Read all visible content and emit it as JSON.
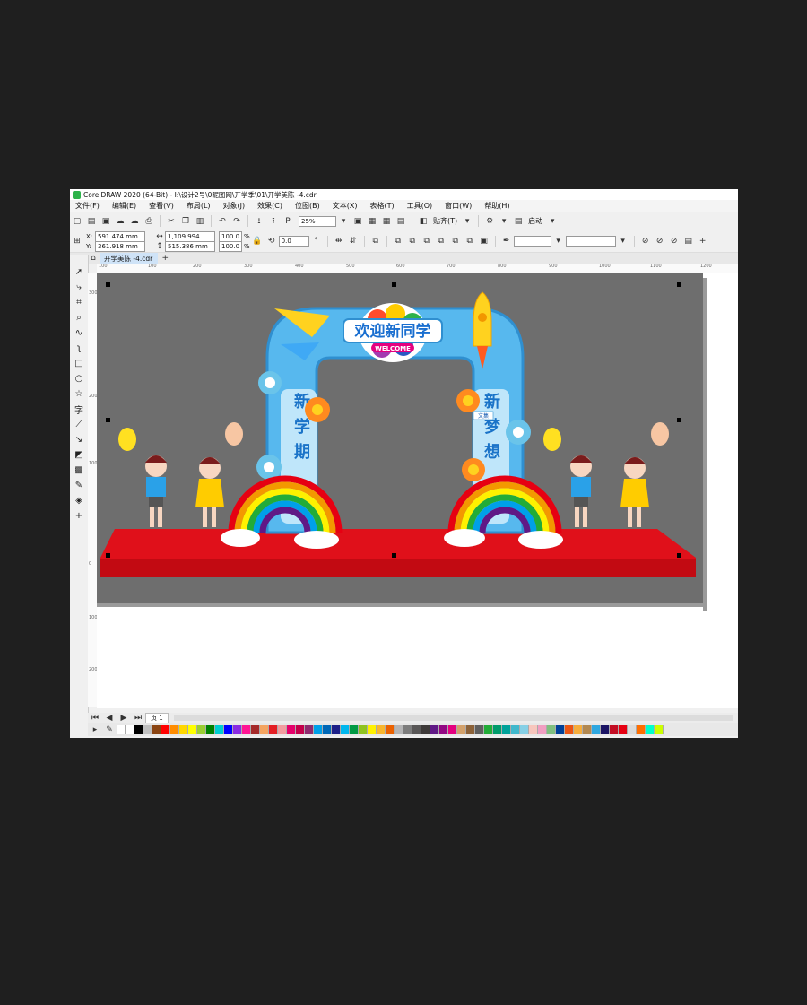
{
  "window": {
    "title": "CorelDRAW 2020 (64-Bit) - I:\\设计2号\\0昵图网\\开学季\\01\\开学美陈 -4.cdr"
  },
  "menu": [
    "文件(F)",
    "编辑(E)",
    "查看(V)",
    "布局(L)",
    "对象(J)",
    "效果(C)",
    "位图(B)",
    "文本(X)",
    "表格(T)",
    "工具(O)",
    "窗口(W)",
    "帮助(H)"
  ],
  "toolbar": {
    "zoom": "25%",
    "paste_label": "贴齐(T)",
    "launch_label": "启动"
  },
  "props": {
    "x": "591.474 mm",
    "y": "361.918 mm",
    "w": "1,109.994 mm",
    "h": "515.386 mm",
    "sx": "100.0",
    "sy": "100.0",
    "pct": "%",
    "angle": "0.0",
    "x_label": "X:",
    "y_label": "Y:"
  },
  "document": {
    "tab": "开学美陈 -4.cdr",
    "page_tab": "页 1"
  },
  "ruler": {
    "h": [
      "100",
      "200",
      "300",
      "400",
      "500",
      "600",
      "700",
      "800",
      "900",
      "1000",
      "1100",
      "1200"
    ],
    "v": [
      "300",
      "200",
      "100",
      "0",
      "100",
      "200"
    ]
  },
  "artwork": {
    "banner_cn": "欢迎新同学",
    "banner_en": "WELCOME",
    "left_column": [
      "新",
      "学",
      "期"
    ],
    "right_column": [
      "新",
      "梦",
      "想"
    ],
    "hint_label": "文集",
    "colors": {
      "stage_bg": "#6e6e6e",
      "floor": "#e0101a",
      "arch": "#57b8ee",
      "arch_inner": "#bfe6fa"
    }
  },
  "palette": [
    "#ffffff",
    "#000000",
    "#c0c0c0",
    "#8b4513",
    "#ff0000",
    "#ff8c00",
    "#ffd700",
    "#ffff00",
    "#9acd32",
    "#008000",
    "#00ced1",
    "#0000ff",
    "#8a2be2",
    "#ff1493",
    "#a52a2a",
    "#f4a460",
    "#e31e24",
    "#f29c9f",
    "#e5006a",
    "#c4004b",
    "#8f2a6f",
    "#00a0e9",
    "#0068b7",
    "#1d2088",
    "#00b7ee",
    "#009944",
    "#8fc31f",
    "#fff100",
    "#f8b62d",
    "#eb6100",
    "#b5b5b6",
    "#7d7d7d",
    "#595757",
    "#3e3a39",
    "#601986",
    "#920783",
    "#e4007f",
    "#d3a16b",
    "#8c6239",
    "#5f5f5f",
    "#22ac38",
    "#009b6b",
    "#00a29a",
    "#40b8cc",
    "#86d0e6",
    "#f7c6bd",
    "#f19ec2",
    "#7fbf7f",
    "#004098",
    "#ea5514",
    "#f6ad3c",
    "#b28850",
    "#2ea7e0",
    "#1b1464",
    "#c30d23",
    "#e60012",
    "#dbdcdc",
    "#ff6e00",
    "#00ffcc",
    "#ccff00"
  ]
}
